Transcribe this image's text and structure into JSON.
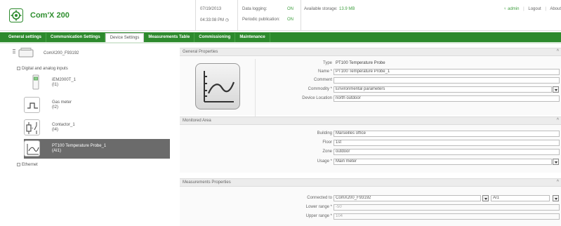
{
  "header": {
    "brand": "Com'X 200",
    "date": "07/19/2013",
    "time": "04:33:08 PM",
    "data_logging_label": "Data logging:",
    "data_logging_value": "ON",
    "periodic_label": "Periodic publication:",
    "periodic_value": "ON",
    "storage_label": "Available storage:",
    "storage_value": "13.9 MB",
    "user": "admin",
    "logout": "Logout",
    "about": "About"
  },
  "tabs": [
    {
      "label": "General settings"
    },
    {
      "label": "Communication Settings"
    },
    {
      "label": "Device Settings"
    },
    {
      "label": "Measurements Table"
    },
    {
      "label": "Commissioning"
    },
    {
      "label": "Maintenance"
    }
  ],
  "tree": {
    "root_label": "ComX200_F93192",
    "group_inputs": "Digital and analog inputs",
    "items": [
      {
        "name": "iEM2000T_1",
        "sub": "(I1)"
      },
      {
        "name": "Gas meter",
        "sub": "(I2)"
      },
      {
        "name": "Contactor_1",
        "sub": "(I4)"
      },
      {
        "name": "PT100 Temperature Probe_1",
        "sub": "(AI1)"
      }
    ],
    "group_ethernet": "Ethernet"
  },
  "general": {
    "title": "General Properties",
    "type_label": "Type",
    "type_value": "PT100 Temperature Probe",
    "name_label": "Name *",
    "name_value": "PT100 Temperature Probe_1",
    "comment_label": "Comment",
    "comment_value": "",
    "commodity_label": "Commodity *",
    "commodity_value": "Environmental parameters",
    "location_label": "Device Location",
    "location_value": "north outdoor"
  },
  "monitored": {
    "title": "Monitored Area",
    "building_label": "Building",
    "building_value": "Marseilles office",
    "floor_label": "Floor",
    "floor_value": "1st",
    "zone_label": "Zone",
    "zone_value": "outdoor",
    "usage_label": "Usage *",
    "usage_value": "Main meter"
  },
  "measurements": {
    "title": "Measurements Properties",
    "connected_label": "Connected to",
    "connected_value": "ComX200_F93192",
    "channel_value": "AI1",
    "lower_label": "Lower range *",
    "lower_value": "-50",
    "upper_label": "Upper range *",
    "upper_value": "104"
  },
  "colors": {
    "brand_green": "#2d8a2d",
    "on_green": "#3f9f3f",
    "selected_gray": "#6b6b6b"
  }
}
